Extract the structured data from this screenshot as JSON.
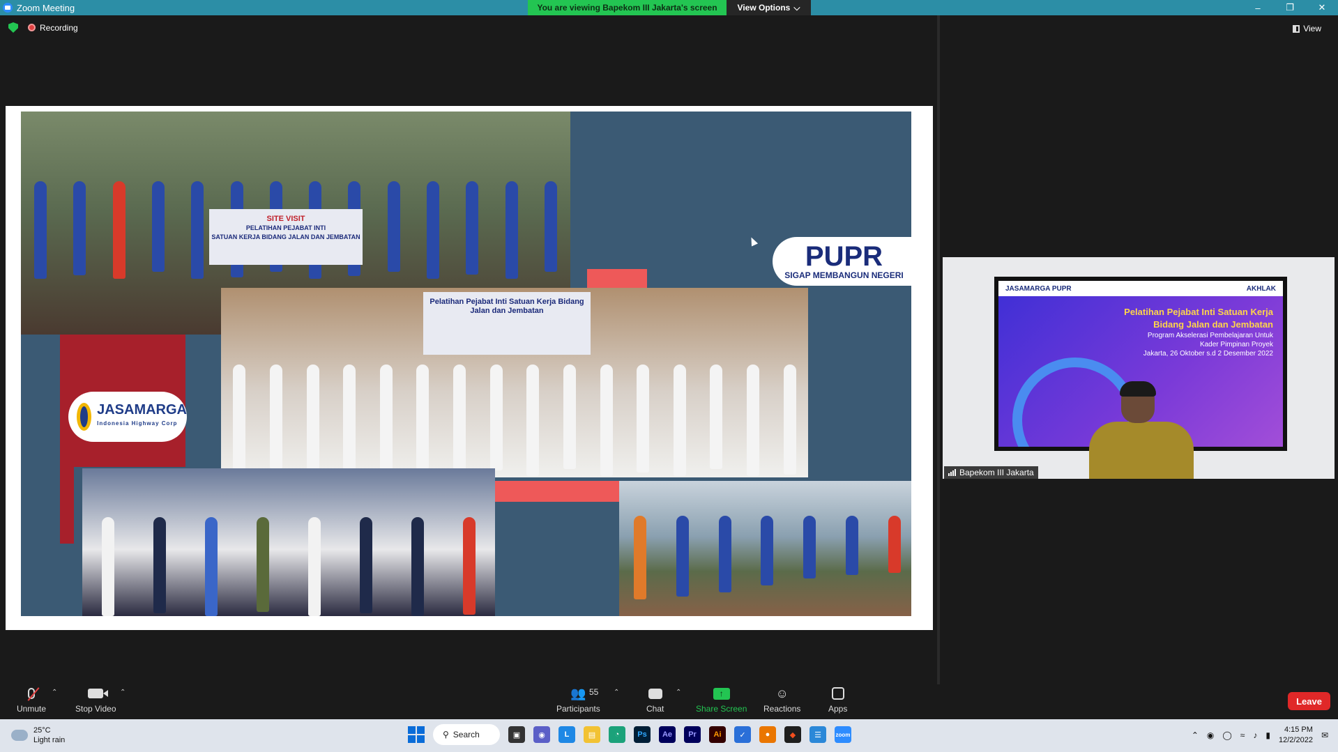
{
  "window": {
    "title": "Zoom Meeting",
    "share_banner": "You are viewing Bapekom III Jakarta's screen",
    "view_options": "View Options",
    "controls": [
      "–",
      "❐",
      "✕"
    ]
  },
  "status": {
    "recording": "Recording",
    "view": "View"
  },
  "slide": {
    "site_visit_title": "SITE VISIT",
    "site_visit_line1": "PELATIHAN PEJABAT INTI",
    "site_visit_line2": "SATUAN KERJA BIDANG JALAN DAN JEMBATAN",
    "hall_banner": "Pelatihan Pejabat Inti Satuan Kerja Bidang Jalan dan Jembatan",
    "jasamarga_name": "JASAMARGA",
    "jasamarga_sub": "Indonesia Highway Corp",
    "pupr_name": "PUPR",
    "pupr_tagline": "SIGAP MEMBANGUN NEGERI"
  },
  "participant": {
    "name": "Bapekom III Jakarta",
    "tv_header_left": "JASAMARGA  PUPR",
    "tv_header_right": "AKHLAK",
    "tv_title1": "Pelatihan Pejabat Inti Satuan Kerja",
    "tv_title2": "Bidang Jalan dan Jembatan",
    "tv_sub1": "Program Akselerasi Pembelajaran Untuk",
    "tv_sub2": "Kader Pimpinan Proyek",
    "tv_date": "Jakarta, 26 Oktober s.d 2 Desember 2022"
  },
  "toolbar": {
    "unmute": "Unmute",
    "stop_video": "Stop Video",
    "participants": "Participants",
    "participant_count": "55",
    "chat": "Chat",
    "share_screen": "Share Screen",
    "reactions": "Reactions",
    "apps": "Apps",
    "leave": "Leave"
  },
  "taskbar": {
    "temperature": "25°C",
    "weather": "Light rain",
    "search": "Search",
    "time": "4:15 PM",
    "date": "12/2/2022"
  },
  "colors": {
    "title_bar": "#2c8ea6",
    "share_green": "#23c552",
    "leave_red": "#e02828",
    "slide_blue": "#3b5a74",
    "slide_red": "#a7202b"
  }
}
